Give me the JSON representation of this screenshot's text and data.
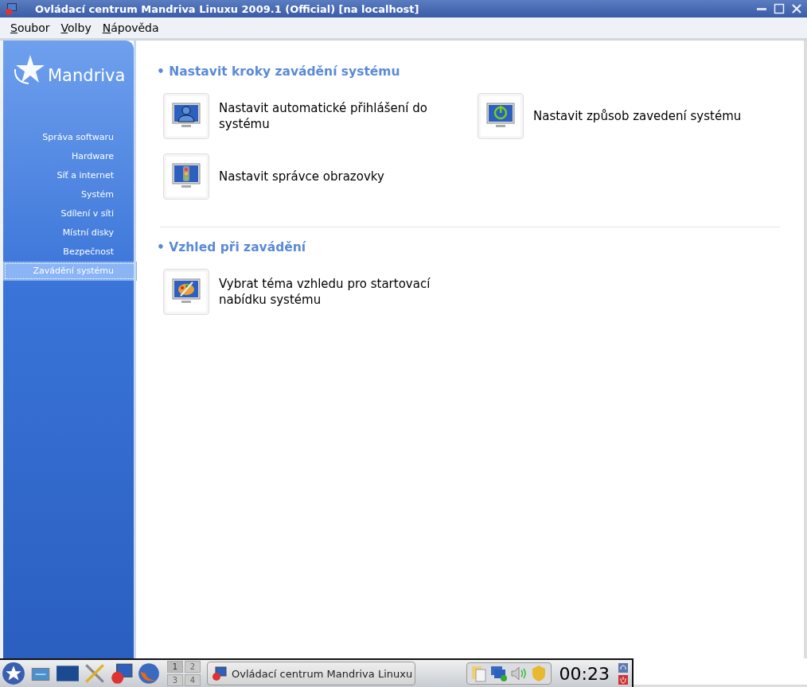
{
  "window": {
    "title": "Ovládací centrum Mandriva Linuxu 2009.1 (Official) [na localhost]"
  },
  "menu": [
    "Soubor",
    "Volby",
    "Nápověda"
  ],
  "sidebar": {
    "logo": "Mandriva",
    "items": [
      {
        "label": "Správa softwaru",
        "selected": false
      },
      {
        "label": "Hardware",
        "selected": false
      },
      {
        "label": "Síť a internet",
        "selected": false
      },
      {
        "label": "Systém",
        "selected": false
      },
      {
        "label": "Sdílení v síti",
        "selected": false
      },
      {
        "label": "Místní disky",
        "selected": false
      },
      {
        "label": "Bezpečnost",
        "selected": false
      },
      {
        "label": "Zavádění systému",
        "selected": true
      }
    ]
  },
  "sections": [
    {
      "title": "• Nastavit kroky zavádění systému",
      "items": [
        {
          "label": "Nastavit automatické přihlášení do systému",
          "kind": "user"
        },
        {
          "label": "Nastavit způsob zavedení systému",
          "kind": "power"
        },
        {
          "label": "Nastavit správce obrazovky",
          "kind": "lights"
        }
      ]
    },
    {
      "title": "• Vzhled při zavádění",
      "items": [
        {
          "label": "Vybrat téma vzhledu pro startovací nabídku systému",
          "kind": "palette"
        }
      ]
    }
  ],
  "taskbar": {
    "pager": [
      {
        "label": "1",
        "selected": true
      },
      {
        "label": "2",
        "selected": false
      },
      {
        "label": "3",
        "selected": false
      },
      {
        "label": "4",
        "selected": false
      }
    ],
    "task": "Ovládací centrum Mandriva Linuxu",
    "clock": "00:23"
  }
}
